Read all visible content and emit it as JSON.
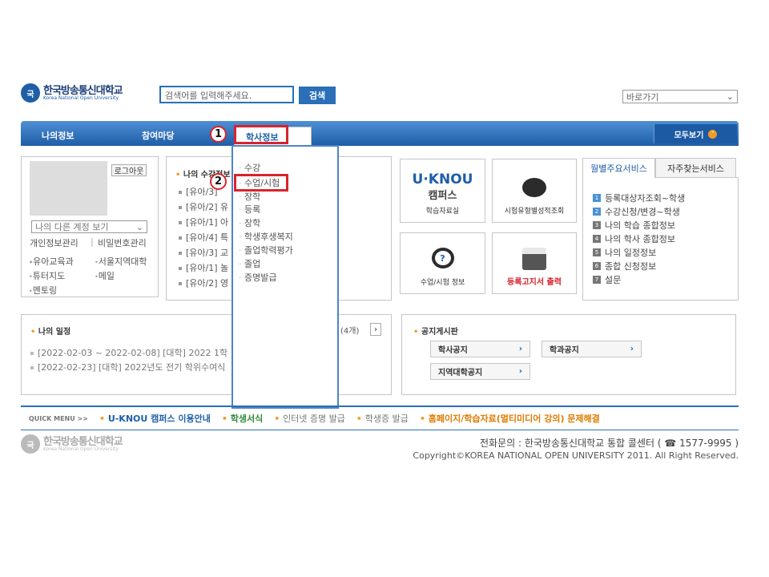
{
  "header": {
    "logo_mark": "국",
    "logo_ko": "한국방송통신대학교",
    "logo_en": "Korea National Open University",
    "search_placeholder": "검색어를 입력해주세요.",
    "search_button": "검색",
    "shortcut_label": "바로가기"
  },
  "nav": {
    "items": [
      "나의정보",
      "참여마당",
      "학사정보"
    ],
    "all_label": "모두보기"
  },
  "markers": [
    "1",
    "2"
  ],
  "profile": {
    "logout": "로그아웃",
    "account_select": "나의 다른 계정 보기",
    "account_links": [
      "개인정보관리",
      "비밀번호관리"
    ],
    "links": [
      "유아교육과",
      "서울지역대학",
      "튜터지도",
      "메일",
      "멘토링"
    ]
  },
  "my_courses": {
    "title": "나의 수강정보",
    "items": [
      "[유아/3]",
      "[유아/2] 유",
      "[유아/1] 아",
      "[유아/4] 특",
      "[유아/3] 교",
      "[유아/1] 놀",
      "[유아/2] 영"
    ]
  },
  "dropdown": {
    "items": [
      "수강",
      "수업/시험",
      "장학",
      "등록",
      "장학",
      "학생후생복지",
      "졸업학력평가",
      "졸업",
      "증명발급"
    ]
  },
  "tiles": [
    {
      "title": "U·KNOU 캠퍼스",
      "caption": "학습자료실"
    },
    {
      "title": "",
      "caption": "시험유형별성적조회"
    },
    {
      "title": "",
      "caption": "수업/시험 정보"
    },
    {
      "title": "",
      "caption": "등록고지서 출력"
    }
  ],
  "services": {
    "tab_on": "월별주요서비스",
    "tab_off": "자주찾는서비스",
    "items": [
      "등록대상자조회~학생",
      "수강신청/변경~학생",
      "나의 학습 종합정보",
      "나의 학사 종합정보",
      "나의 일정정보",
      "종합 신청정보",
      "설문"
    ]
  },
  "schedule": {
    "title": "나의 일정",
    "count": "(4개)",
    "items": [
      "[2022-02-03 ~ 2022-02-08] [대학] 2022 1학",
      "[2022-02-23] [대학] 2022년도 전기 학위수여식"
    ]
  },
  "notice": {
    "title": "공지게시판",
    "buttons": [
      "학사공지",
      "학과공지",
      "지역대학공지"
    ]
  },
  "quick": {
    "label": "QUICK MENU >>",
    "links": [
      "U-KNOU 캠퍼스 이용안내",
      "학생서식",
      "인터넷 증명 발급",
      "학생증 발급",
      "홈페이지/학습자료(멀티미디어 강의) 문제해결"
    ]
  },
  "footer": {
    "contact": "전화문의 : 한국방송통신대학교 통합 콜센터 ( ☎ 1577-9995 )",
    "copyright": "Copyright©KOREA NATIONAL OPEN UNIVERSITY 2011. All Right Reserved."
  },
  "colors": {
    "primary": "#1e5ea8",
    "accent": "#f59a23",
    "highlight": "#d8242c"
  }
}
